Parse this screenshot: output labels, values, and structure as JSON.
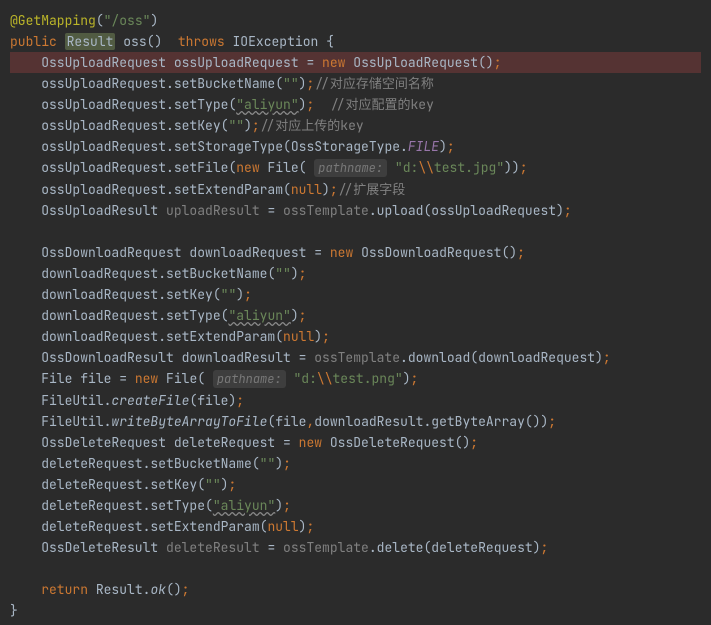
{
  "l1": {
    "ann": "@GetMapping",
    "s": "\"/oss\""
  },
  "l2": {
    "kw1": "public",
    "type": "Result",
    "name": "oss",
    "kw2": "throws",
    "exc": "IOException"
  },
  "l3": {
    "t": "OssUploadRequest",
    "v": "ossUploadRequest",
    "kw": "new",
    "c": "OssUploadRequest"
  },
  "l4": {
    "o": "ossUploadRequest",
    "m": "setBucketName",
    "s": "\"\"",
    "cm": "//对应存储空间名称"
  },
  "l5": {
    "o": "ossUploadRequest",
    "m": "setType",
    "s": "\"aliyun\"",
    "cm": "//对应配置的key"
  },
  "l6": {
    "o": "ossUploadRequest",
    "m": "setKey",
    "s": "\"\"",
    "cm": "//对应上传的key"
  },
  "l7": {
    "o": "ossUploadRequest",
    "m": "setStorageType",
    "a": "OssStorageType",
    "f": "FILE"
  },
  "l8": {
    "o": "ossUploadRequest",
    "m": "setFile",
    "kw": "new",
    "c": "File",
    "pl": "pathname:",
    "s": "\"d:\\\\test.jpg\""
  },
  "l9": {
    "o": "ossUploadRequest",
    "m": "setExtendParam",
    "v": "null",
    "cm": "//扩展字段"
  },
  "l10": {
    "t": "OssUploadResult",
    "v": "uploadResult",
    "o": "ossTemplate",
    "m": "upload",
    "a": "ossUploadRequest"
  },
  "l12": {
    "t": "OssDownloadRequest",
    "v": "downloadRequest",
    "kw": "new",
    "c": "OssDownloadRequest"
  },
  "l13": {
    "o": "downloadRequest",
    "m": "setBucketName",
    "s": "\"\""
  },
  "l14": {
    "o": "downloadRequest",
    "m": "setKey",
    "s": "\"\""
  },
  "l15": {
    "o": "downloadRequest",
    "m": "setType",
    "s": "\"aliyun\""
  },
  "l16": {
    "o": "downloadRequest",
    "m": "setExtendParam",
    "v": "null"
  },
  "l17": {
    "t": "OssDownloadResult",
    "v": "downloadResult",
    "o": "ossTemplate",
    "m": "download",
    "a": "downloadRequest"
  },
  "l18": {
    "t": "File",
    "v": "file",
    "kw": "new",
    "c": "File",
    "pl": "pathname:",
    "s": "\"d:\\\\test.png\""
  },
  "l19": {
    "o": "FileUtil",
    "m": "createFile",
    "a": "file"
  },
  "l20": {
    "o": "FileUtil",
    "m": "writeByteArrayToFile",
    "a": "file",
    "o2": "downloadResult",
    "m2": "getByteArray"
  },
  "l21": {
    "t": "OssDeleteRequest",
    "v": "deleteRequest",
    "kw": "new",
    "c": "OssDeleteRequest"
  },
  "l22": {
    "o": "deleteRequest",
    "m": "setBucketName",
    "s": "\"\""
  },
  "l23": {
    "o": "deleteRequest",
    "m": "setKey",
    "s": "\"\""
  },
  "l24": {
    "o": "deleteRequest",
    "m": "setType",
    "s": "\"aliyun\""
  },
  "l25": {
    "o": "deleteRequest",
    "m": "setExtendParam",
    "v": "null"
  },
  "l26": {
    "t": "OssDeleteResult",
    "v": "deleteResult",
    "o": "ossTemplate",
    "m": "delete",
    "a": "deleteRequest"
  },
  "l28": {
    "kw": "return",
    "c": "Result",
    "m": "ok"
  }
}
